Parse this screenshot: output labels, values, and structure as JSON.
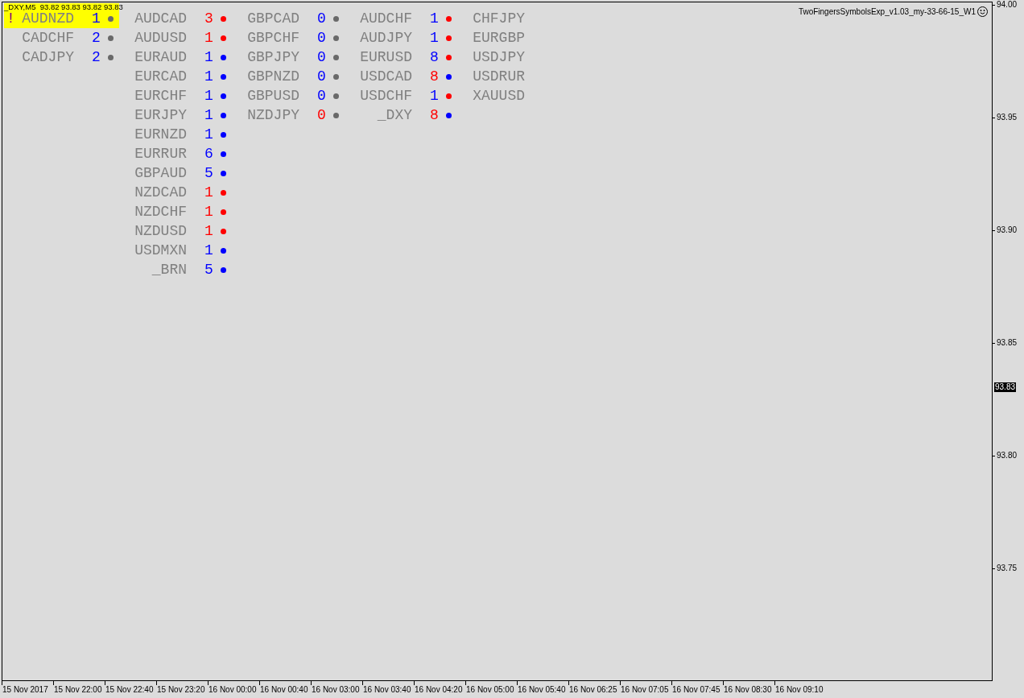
{
  "chart_header": "_DXY,M5  93.82 93.83 93.82 93.83",
  "indicator_label": "TwoFingersSymbolsExp_v1.03_my-33-66-15_W1",
  "columns": [
    {
      "items": [
        {
          "flag": "!",
          "symbol": "AUDNZD",
          "count": {
            "value": "1",
            "color": "#0000ff"
          },
          "dot": {
            "color": "#696969"
          },
          "selected": true
        },
        {
          "symbol": "CADCHF",
          "count": {
            "value": "2",
            "color": "#0000ff"
          },
          "dot": {
            "color": "#696969"
          },
          "selected": false
        },
        {
          "symbol": "CADJPY",
          "count": {
            "value": "2",
            "color": "#0000ff"
          },
          "dot": {
            "color": "#696969"
          },
          "selected": false
        }
      ]
    },
    {
      "items": [
        {
          "symbol": "AUDCAD",
          "count": {
            "value": "3",
            "color": "#ff0000"
          },
          "dot": {
            "color": "#ff0000"
          },
          "selected": false
        },
        {
          "symbol": "AUDUSD",
          "count": {
            "value": "1",
            "color": "#ff0000"
          },
          "dot": {
            "color": "#ff0000"
          },
          "selected": false
        },
        {
          "symbol": "EURAUD",
          "count": {
            "value": "1",
            "color": "#0000ff"
          },
          "dot": {
            "color": "#0000ff"
          },
          "selected": false
        },
        {
          "symbol": "EURCAD",
          "count": {
            "value": "1",
            "color": "#0000ff"
          },
          "dot": {
            "color": "#0000ff"
          },
          "selected": false
        },
        {
          "symbol": "EURCHF",
          "count": {
            "value": "1",
            "color": "#0000ff"
          },
          "dot": {
            "color": "#0000ff"
          },
          "selected": false
        },
        {
          "symbol": "EURJPY",
          "count": {
            "value": "1",
            "color": "#0000ff"
          },
          "dot": {
            "color": "#0000ff"
          },
          "selected": false
        },
        {
          "symbol": "EURNZD",
          "count": {
            "value": "1",
            "color": "#0000ff"
          },
          "dot": {
            "color": "#0000ff"
          },
          "selected": false
        },
        {
          "symbol": "EURRUR",
          "count": {
            "value": "6",
            "color": "#0000ff"
          },
          "dot": {
            "color": "#0000ff"
          },
          "selected": false
        },
        {
          "symbol": "GBPAUD",
          "count": {
            "value": "5",
            "color": "#0000ff"
          },
          "dot": {
            "color": "#0000ff"
          },
          "selected": false
        },
        {
          "symbol": "NZDCAD",
          "count": {
            "value": "1",
            "color": "#ff0000"
          },
          "dot": {
            "color": "#ff0000"
          },
          "selected": false
        },
        {
          "symbol": "NZDCHF",
          "count": {
            "value": "1",
            "color": "#ff0000"
          },
          "dot": {
            "color": "#ff0000"
          },
          "selected": false
        },
        {
          "symbol": "NZDUSD",
          "count": {
            "value": "1",
            "color": "#ff0000"
          },
          "dot": {
            "color": "#ff0000"
          },
          "selected": false
        },
        {
          "symbol": "USDMXN",
          "count": {
            "value": "1",
            "color": "#0000ff"
          },
          "dot": {
            "color": "#0000ff"
          },
          "selected": false
        },
        {
          "symbol": "_BRN",
          "count": {
            "value": "5",
            "color": "#0000ff"
          },
          "dot": {
            "color": "#0000ff"
          },
          "selected": false
        }
      ]
    },
    {
      "items": [
        {
          "symbol": "GBPCAD",
          "count": {
            "value": "0",
            "color": "#0000ff"
          },
          "dot": {
            "color": "#696969"
          },
          "selected": false
        },
        {
          "symbol": "GBPCHF",
          "count": {
            "value": "0",
            "color": "#0000ff"
          },
          "dot": {
            "color": "#696969"
          },
          "selected": false
        },
        {
          "symbol": "GBPJPY",
          "count": {
            "value": "0",
            "color": "#0000ff"
          },
          "dot": {
            "color": "#696969"
          },
          "selected": false
        },
        {
          "symbol": "GBPNZD",
          "count": {
            "value": "0",
            "color": "#0000ff"
          },
          "dot": {
            "color": "#696969"
          },
          "selected": false
        },
        {
          "symbol": "GBPUSD",
          "count": {
            "value": "0",
            "color": "#0000ff"
          },
          "dot": {
            "color": "#696969"
          },
          "selected": false
        },
        {
          "symbol": "NZDJPY",
          "count": {
            "value": "0",
            "color": "#ff0000"
          },
          "dot": {
            "color": "#696969"
          },
          "selected": false
        }
      ]
    },
    {
      "items": [
        {
          "symbol": "AUDCHF",
          "count": {
            "value": "1",
            "color": "#0000ff"
          },
          "dot": {
            "color": "#ff0000"
          },
          "selected": false
        },
        {
          "symbol": "AUDJPY",
          "count": {
            "value": "1",
            "color": "#0000ff"
          },
          "dot": {
            "color": "#ff0000"
          },
          "selected": false
        },
        {
          "symbol": "EURUSD",
          "count": {
            "value": "8",
            "color": "#0000ff"
          },
          "dot": {
            "color": "#ff0000"
          },
          "selected": false
        },
        {
          "symbol": "USDCAD",
          "count": {
            "value": "8",
            "color": "#ff0000"
          },
          "dot": {
            "color": "#0000ff"
          },
          "selected": false
        },
        {
          "symbol": "USDCHF",
          "count": {
            "value": "1",
            "color": "#0000ff"
          },
          "dot": {
            "color": "#ff0000"
          },
          "selected": false
        },
        {
          "symbol": "_DXY",
          "count": {
            "value": "8",
            "color": "#ff0000"
          },
          "dot": {
            "color": "#0000ff"
          },
          "selected": false
        }
      ]
    },
    {
      "items": [
        {
          "symbol": "CHFJPY",
          "selected": false
        },
        {
          "symbol": "EURGBP",
          "selected": false
        },
        {
          "symbol": "USDJPY",
          "selected": false
        },
        {
          "symbol": "USDRUR",
          "selected": false
        },
        {
          "symbol": "XAUUSD",
          "selected": false
        }
      ]
    }
  ],
  "price_axis": {
    "labels": [
      "94.00",
      "93.95",
      "93.90",
      "93.85",
      "93.80",
      "93.75"
    ],
    "current_price": "93.83"
  },
  "time_axis": {
    "labels": [
      "15 Nov 2017",
      "15 Nov 22:00",
      "15 Nov 22:40",
      "15 Nov 23:20",
      "16 Nov 00:00",
      "16 Nov 00:40",
      "16 Nov 03:00",
      "16 Nov 03:40",
      "16 Nov 04:20",
      "16 Nov 05:00",
      "16 Nov 05:40",
      "16 Nov 06:25",
      "16 Nov 07:05",
      "16 Nov 07:45",
      "16 Nov 08:30",
      "16 Nov 09:10"
    ]
  }
}
